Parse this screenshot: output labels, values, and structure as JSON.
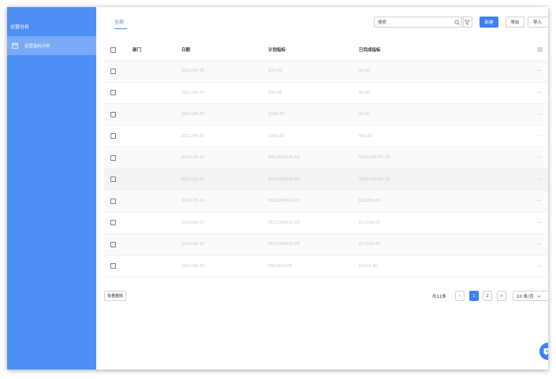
{
  "sidebar": {
    "title": "运营分析",
    "items": [
      {
        "label": "运营指标分析"
      }
    ]
  },
  "main": {
    "tabs": [
      {
        "label": "全部"
      }
    ],
    "toolbar": {
      "search_placeholder": "搜索",
      "new_label": "新建",
      "export_label": "导出",
      "import_label": "导入"
    },
    "table": {
      "columns": [
        "部门",
        "日期",
        "计划指标",
        "已完成指标"
      ],
      "rows": [
        {
          "date": "2021-05-28",
          "plan": "100.00",
          "done": "10.00"
        },
        {
          "date": "2021-05-24",
          "plan": "100.00",
          "done": "50.00"
        },
        {
          "date": "2021-05-20",
          "plan": "1000.00",
          "done": "10.00"
        },
        {
          "date": "2021-05-25",
          "plan": "1000.00",
          "done": "800.00"
        },
        {
          "date": "2020-08-19",
          "plan": "6013456245.00",
          "done": "5656156781.00"
        },
        {
          "date": "2021-02-19",
          "plan": "6013456245.00",
          "done": "5656156781.00"
        },
        {
          "date": "2020-05-19",
          "plan": "5612345622.00",
          "done": "611356.00"
        },
        {
          "date": "2020-05-20",
          "plan": "5612345622.00",
          "done": "611356.00"
        },
        {
          "date": "2020-05-19",
          "plan": "5612345622.00",
          "done": "611356.00"
        },
        {
          "date": "2021-04-19",
          "plan": "5891422.00",
          "done": "52311.00"
        }
      ],
      "row_action": "···"
    },
    "footer": {
      "batch_delete": "批量删除",
      "total": "共11条",
      "prev": "<",
      "page1": "1",
      "page2": "2",
      "next": ">",
      "page_size": "10 条/页"
    }
  },
  "colors": {
    "primary": "#3d7ff5",
    "sidebar": "#4e8ff5",
    "sidebar_active": "#7aaaf7"
  }
}
